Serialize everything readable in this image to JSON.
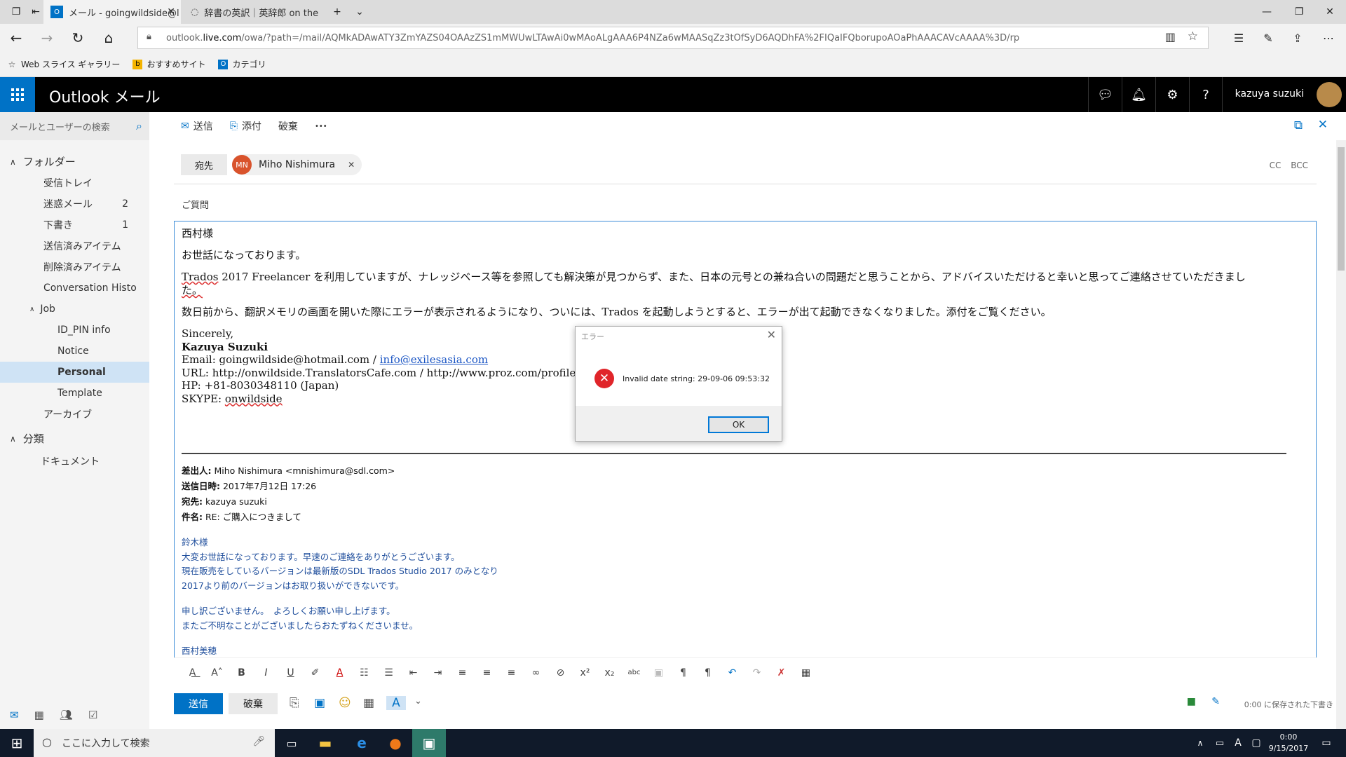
{
  "browser": {
    "tabs": [
      {
        "label": "メール - goingwildside@l",
        "active": true
      },
      {
        "label": "辞書の英訳｜英辞郎 on the",
        "active": false
      }
    ],
    "url_prefix": "outlook.",
    "url_host": "live.com",
    "url_rest": "/owa/?path=/mail/AQMkADAwATY3ZmYAZS04OAAzZS1mMWUwLTAwAi0wMAoALgAAA6P4NZa6wMAASqZz3tOfSyD6AQDhFA%2FIQaIFQborupoAOaPhAAACAVcAAAA%3D/rp",
    "favorites": [
      "Web スライス ギャラリー",
      "おすすめサイト",
      "カテゴリ"
    ]
  },
  "outlook": {
    "title": "Outlook メール",
    "user_name": "kazuya suzuki",
    "search_placeholder": "メールとユーザーの検索"
  },
  "folders": {
    "header": "フォルダー",
    "items": [
      {
        "label": "受信トレイ",
        "count": ""
      },
      {
        "label": "迷惑メール",
        "count": "2"
      },
      {
        "label": "下書き",
        "count": "1"
      },
      {
        "label": "送信済みアイテム",
        "count": ""
      },
      {
        "label": "削除済みアイテム",
        "count": ""
      },
      {
        "label": "Conversation Histo",
        "count": ""
      },
      {
        "label": "Job",
        "count": ""
      },
      {
        "label": "ID_PIN info",
        "count": ""
      },
      {
        "label": "Notice",
        "count": ""
      },
      {
        "label": "Personal",
        "count": ""
      },
      {
        "label": "Template",
        "count": ""
      },
      {
        "label": "アーカイブ",
        "count": ""
      }
    ],
    "categories_header": "分類",
    "categories_item": "ドキュメント"
  },
  "toolbar": {
    "send": "送信",
    "attach": "添付",
    "discard": "破棄",
    "more": "•••"
  },
  "compose": {
    "to_label": "宛先",
    "recipient_initials": "MN",
    "recipient_name": "Miho Nishimura",
    "cc_bcc": "CC BCC",
    "subject": "ご質問",
    "greeting": "西村様",
    "p1": "お世話になっております。",
    "p2a": "Trados",
    "p2b": " 2017 Freelancer を利用していますが、ナレッジベース等を参照しても解決策が見つからず、また、日本の元号との兼ね合いの問題だと思うことから、アドバイスいただけると幸いと思ってご連絡させていただきまし",
    "p2c": "た。",
    "p3": "数日前から、翻訳メモリの画面を開いた際にエラーが表示されるようになり、ついには、Trados を起動しようとすると、エラーが出て起動できなくなりました。添付をご覧ください。",
    "sig_closing": "Sincerely,",
    "sig_name": "Kazuya Suzuki",
    "sig_email_label": "Email: goingwildside@hotmail.com / ",
    "sig_email_link": "info@exilesasia.com",
    "sig_url": "URL: http://onwildside.TranslatorsCafe.com / http://www.proz.com/profile/569787",
    "sig_hp": "HP: +81-8030348110 (Japan)",
    "sig_skype_label": "SKYPE: ",
    "sig_skype": "onwildside"
  },
  "quoted": {
    "from_label": "差出人:",
    "from": " Miho Nishimura <mnishimura@sdl.com>",
    "date_label": "送信日時:",
    "date": " 2017年7月12日 17:26",
    "to_label": "宛先:",
    "to": " kazuya suzuki",
    "subject_label": "件名:",
    "subject": " RE: ご購入につきまして",
    "lines": [
      "鈴木様",
      "大変お世話になっております。早速のご連絡をありがとうございます。",
      "現在販売をしているバージョンは最新版のSDL Trados Studio 2017 のみとなり",
      "2017より前のバージョンはお取り扱いができないです。",
      "",
      "申し訳ございません。　よろしくお願い申し上げます。",
      "またご不明なことがございましたらおたずねくださいませ。",
      "",
      "西村美穂"
    ]
  },
  "bottom": {
    "send": "送信",
    "discard": "破棄",
    "saved": "0:00 に保存された下書き"
  },
  "dialog": {
    "title": "エラー",
    "message": "Invalid date string: 29-09-06 09:53:32",
    "ok": "OK"
  },
  "taskbar": {
    "search_placeholder": "ここに入力して検索",
    "time": "0:00",
    "date": "9/15/2017",
    "ime": "A"
  },
  "colors": {
    "accent": "#0072c6",
    "error": "#e0252a",
    "link": "#1a55c4",
    "quote_text": "#1f4e9c"
  }
}
